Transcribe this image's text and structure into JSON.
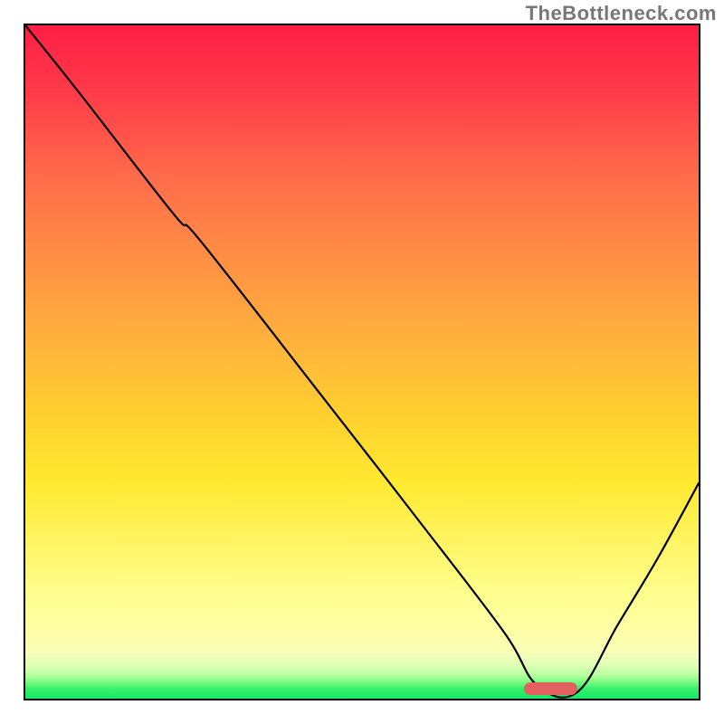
{
  "attribution": "TheBottleneck.com",
  "chart_data": {
    "type": "line",
    "title": "",
    "xlabel": "",
    "ylabel": "",
    "xlim": [
      0,
      100
    ],
    "ylim": [
      0,
      100
    ],
    "x": [
      0,
      8,
      22,
      26,
      44,
      58,
      71,
      76,
      82,
      88,
      94,
      100
    ],
    "values": [
      100,
      90,
      72,
      68,
      45,
      27,
      10,
      2,
      1,
      11,
      21,
      32
    ],
    "marker": {
      "x_start": 74,
      "x_end": 82,
      "y": 1.5
    },
    "notes": "Curve descends from upper-left, dips near bottom around x≈78, then rises again. Background is a red→green vertical gradient."
  }
}
